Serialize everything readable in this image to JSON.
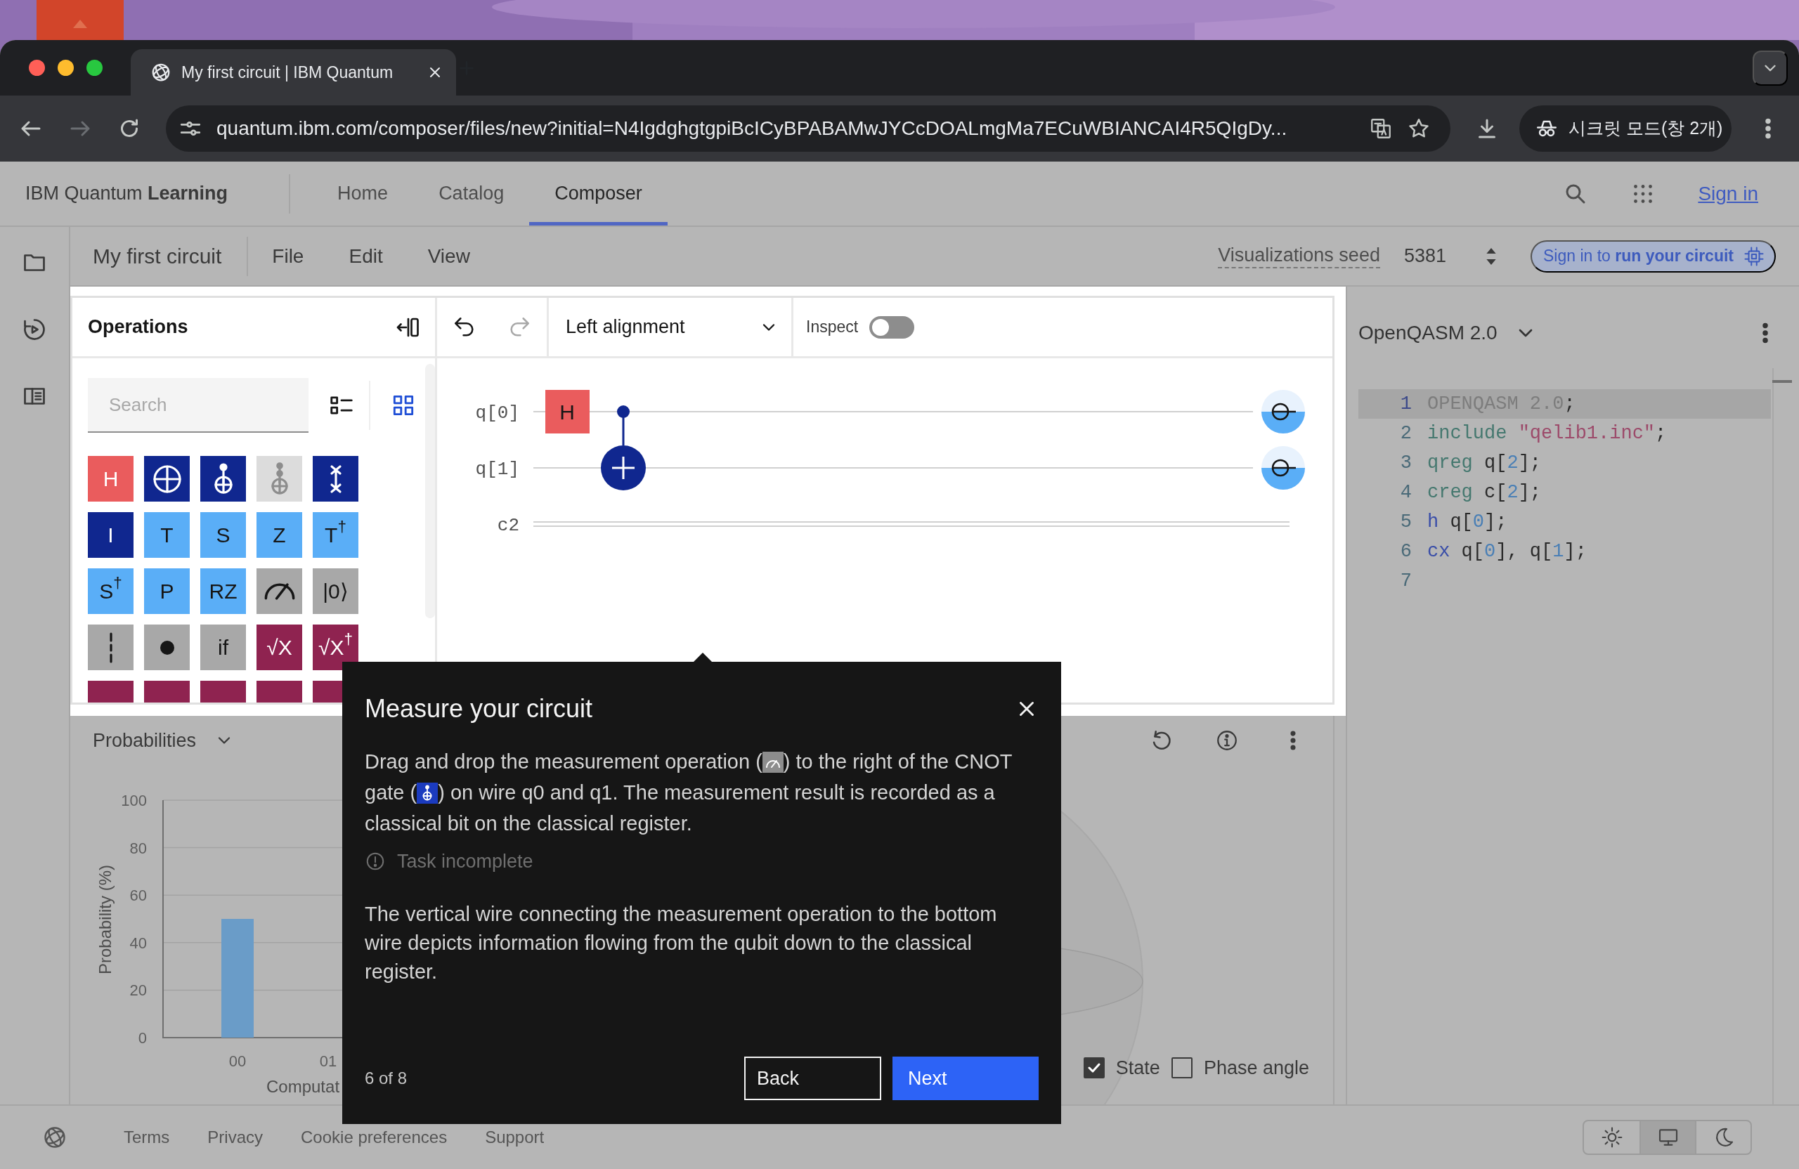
{
  "browser": {
    "traffic_lights": [
      {
        "color": "#ff5f57"
      },
      {
        "color": "#febc2e"
      },
      {
        "color": "#28c840"
      }
    ],
    "tabs": [
      {
        "title": "My first circuit | IBM Quantum",
        "selected": true
      }
    ],
    "url": "quantum.ibm.com/composer/files/new?initial=N4IgdghgtgpiBcICyBPABAMwJYCcDOALmgMa7ECuWBIANCAI4R5QIgDy...",
    "profile": "시크릿 모드(창 2개)"
  },
  "header": {
    "brand": "IBM Quantum **Learning**",
    "nav": [
      {
        "label": "Home",
        "selected": false
      },
      {
        "label": "Catalog",
        "selected": false
      },
      {
        "label": "Composer",
        "selected": true
      }
    ],
    "sign_in": "Sign in"
  },
  "toolbar": {
    "title": "My first circuit",
    "menus": [
      "File",
      "Edit",
      "View"
    ],
    "seed_label": "Visualizations seed",
    "seed_value": "5381",
    "run": "Sign in to **run your circuit**"
  },
  "operations": {
    "title": "Operations",
    "search": {
      "placeholder": "Search"
    },
    "views": [
      {
        "kind": "list",
        "selected": false
      },
      {
        "kind": "grid",
        "selected": true
      }
    ],
    "gates": [
      {
        "kind": "text",
        "label": "H",
        "color": "#ea5c5d"
      },
      {
        "kind": "target",
        "color": "#10278f"
      },
      {
        "kind": "controlled",
        "color": "#10278f"
      },
      {
        "kind": "double",
        "color": "#dcdcdc"
      },
      {
        "kind": "swap",
        "color": "#10278f"
      },
      {
        "kind": "text",
        "label": "I",
        "color": "#10278f"
      },
      {
        "kind": "text",
        "label": "T",
        "color": "#5aaef7"
      },
      {
        "kind": "text",
        "label": "S",
        "color": "#5aaef7"
      },
      {
        "kind": "text",
        "label": "Z",
        "color": "#5aaef7"
      },
      {
        "kind": "text",
        "label": "T$^{†}$",
        "color": "#5aaef7"
      },
      {
        "kind": "text",
        "label": "S$^{†}$",
        "color": "#5aaef7"
      },
      {
        "kind": "text",
        "label": "P",
        "color": "#5aaef7"
      },
      {
        "kind": "text",
        "label": "RZ",
        "color": "#5aaef7"
      },
      {
        "kind": "meter",
        "color": "#a8a8a8"
      },
      {
        "kind": "text",
        "label": "|0⟩",
        "color": "#a8a8a8"
      },
      {
        "kind": "barrier",
        "color": "#a8a8a8"
      },
      {
        "kind": "dot",
        "color": "#a8a8a8"
      },
      {
        "kind": "text",
        "label": "if",
        "color": "#a8a8a8"
      },
      {
        "kind": "text",
        "label": "√X",
        "color": "#8f2350"
      },
      {
        "kind": "text",
        "label": "√X$^{†}$",
        "color": "#8f2350"
      },
      {
        "kind": "cut",
        "color": "#8f2350"
      },
      {
        "kind": "cut",
        "color": "#8f2350"
      },
      {
        "kind": "cut",
        "color": "#8f2350"
      },
      {
        "kind": "cut",
        "color": "#8f2350"
      },
      {
        "kind": "cut",
        "color": "#8f2350"
      }
    ]
  },
  "circuit": {
    "alignment": "Left alignment",
    "inspect": {
      "label": "Inspect",
      "on": false
    },
    "wires": [
      {
        "label": "q[0]",
        "kind": "qubit",
        "cells": [
          {
            "kind": "gate",
            "label": "H",
            "color": "#ea5c5d"
          },
          {
            "kind": "control"
          }
        ]
      },
      {
        "label": "q[1]",
        "kind": "qubit",
        "cells": [
          {
            "kind": "empty"
          },
          {
            "kind": "target"
          }
        ]
      },
      {
        "label": "c2",
        "kind": "classical"
      }
    ]
  },
  "code": {
    "language": "OpenQASM 2.0",
    "lines": [
      {
        "number": "1",
        "selected": true,
        "tokens": [
          {
            "kind": "muted",
            "text": "OPENQASM 2.0"
          },
          {
            "kind": "plain",
            "text": ";"
          }
        ]
      },
      {
        "number": "2",
        "selected": false,
        "tokens": [
          {
            "kind": "keyword",
            "text": "include "
          },
          {
            "kind": "string",
            "text": "\"qelib1.inc\""
          },
          {
            "kind": "plain",
            "text": ";"
          }
        ]
      },
      {
        "number": "3",
        "selected": false,
        "tokens": [
          {
            "kind": "keyword",
            "text": "qreg "
          },
          {
            "kind": "plain",
            "text": "q["
          },
          {
            "kind": "number",
            "text": "2"
          },
          {
            "kind": "plain",
            "text": "];"
          }
        ]
      },
      {
        "number": "4",
        "selected": false,
        "tokens": [
          {
            "kind": "keyword",
            "text": "creg "
          },
          {
            "kind": "plain",
            "text": "c["
          },
          {
            "kind": "number",
            "text": "2"
          },
          {
            "kind": "plain",
            "text": "];"
          }
        ]
      },
      {
        "number": "5",
        "selected": false,
        "tokens": [
          {
            "kind": "gate",
            "text": "h "
          },
          {
            "kind": "plain",
            "text": "q["
          },
          {
            "kind": "number",
            "text": "0"
          },
          {
            "kind": "plain",
            "text": "];"
          }
        ]
      },
      {
        "number": "6",
        "selected": false,
        "tokens": [
          {
            "kind": "gate",
            "text": "cx "
          },
          {
            "kind": "plain",
            "text": "q["
          },
          {
            "kind": "number",
            "text": "0"
          },
          {
            "kind": "plain",
            "text": "], q["
          },
          {
            "kind": "number",
            "text": "1"
          },
          {
            "kind": "plain",
            "text": "];"
          }
        ]
      },
      {
        "number": "7",
        "selected": false
      }
    ]
  },
  "probabilities": {
    "title": "Probabilities",
    "chart_data": {
      "type": "bar",
      "xlabel": "Computat",
      "ylabel": "Probability (%)",
      "categories": [
        "00",
        "01"
      ],
      "values": [
        50,
        0
      ],
      "grid": true,
      "ylim": [
        0,
        100
      ],
      "yticks": [
        0,
        20,
        40,
        60,
        80,
        100
      ]
    }
  },
  "qsphere": {
    "options": [
      {
        "label": "State",
        "checked": true
      },
      {
        "label": "Phase angle",
        "checked": false
      }
    ]
  },
  "tour": {
    "title": "Measure your circuit",
    "body": [
      {
        "kind": "text",
        "text": "Drag and drop the measurement operation ("
      },
      {
        "kind": "meter"
      },
      {
        "kind": "text",
        "text": ") to the right of the CNOT gate ("
      },
      {
        "kind": "cnot"
      },
      {
        "kind": "text",
        "text": ") on wire q0 and q1. The measurement result is recorded as a classical bit on the classical register."
      }
    ],
    "task": {
      "label": "Task incomplete",
      "complete": false
    },
    "note": "The vertical wire connecting the measurement operation to the bottom wire depicts information flowing from the qubit down to the classical register.",
    "step": "6 of 8",
    "buttons": [
      {
        "label": "Back",
        "kind": "secondary"
      },
      {
        "label": "Next",
        "kind": "primary"
      }
    ]
  },
  "footer": {
    "links": [
      "Terms",
      "Privacy",
      "Cookie preferences",
      "Support"
    ],
    "themes": [
      {
        "kind": "light",
        "selected": false
      },
      {
        "kind": "system",
        "selected": true
      },
      {
        "kind": "dark",
        "selected": false
      }
    ]
  }
}
